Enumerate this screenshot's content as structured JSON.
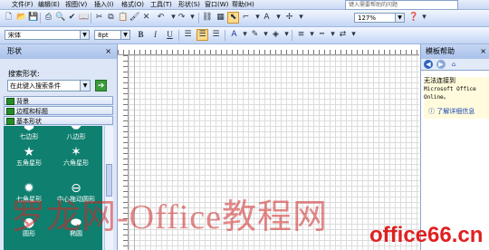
{
  "menubar": {
    "items": [
      "文件(F)",
      "编辑(E)",
      "视图(V)",
      "插入(I)",
      "格式(O)",
      "工具(T)",
      "形状(S)",
      "窗口(W)",
      "帮助(H)"
    ],
    "help_box_placeholder": "键入需要帮助的问题"
  },
  "toolbar1": {
    "zoom": "127%"
  },
  "toolbar2": {
    "font": "宋体",
    "font_size": "8pt",
    "bold": "B",
    "italic": "I",
    "underline": "U"
  },
  "shapes_pane": {
    "title": "形状",
    "close": "×",
    "search_label": "搜索形状:",
    "search_placeholder": "在此键入搜索条件",
    "stencils": [
      "背景",
      "边框和标题",
      "基本形状"
    ],
    "shapes": [
      {
        "name": "七边形",
        "icon": "heptagon-icon",
        "glyph": "⬢"
      },
      {
        "name": "八边形",
        "icon": "octagon-icon",
        "glyph": "⯃"
      },
      {
        "name": "五角星形",
        "icon": "five-point-star-icon",
        "glyph": "★"
      },
      {
        "name": "六角星形",
        "icon": "six-point-star-icon",
        "glyph": "✶"
      },
      {
        "name": "七角星形",
        "icon": "seven-point-star-icon",
        "glyph": "✹"
      },
      {
        "name": "中心拖动圆形",
        "icon": "center-drag-circle-icon",
        "glyph": "⊖"
      },
      {
        "name": "圆形",
        "icon": "circle-icon",
        "glyph": "●"
      },
      {
        "name": "椭圆",
        "icon": "ellipse-icon",
        "glyph": "⬬"
      }
    ]
  },
  "help_pane": {
    "title": "模板帮助",
    "close": "×",
    "message_lines": [
      "无法连接到",
      "Microsoft Office",
      "Online。"
    ],
    "link": "了解详细信息"
  },
  "watermarks": {
    "main": "罗龙网-Office教程网",
    "corner": "office66.cn"
  }
}
